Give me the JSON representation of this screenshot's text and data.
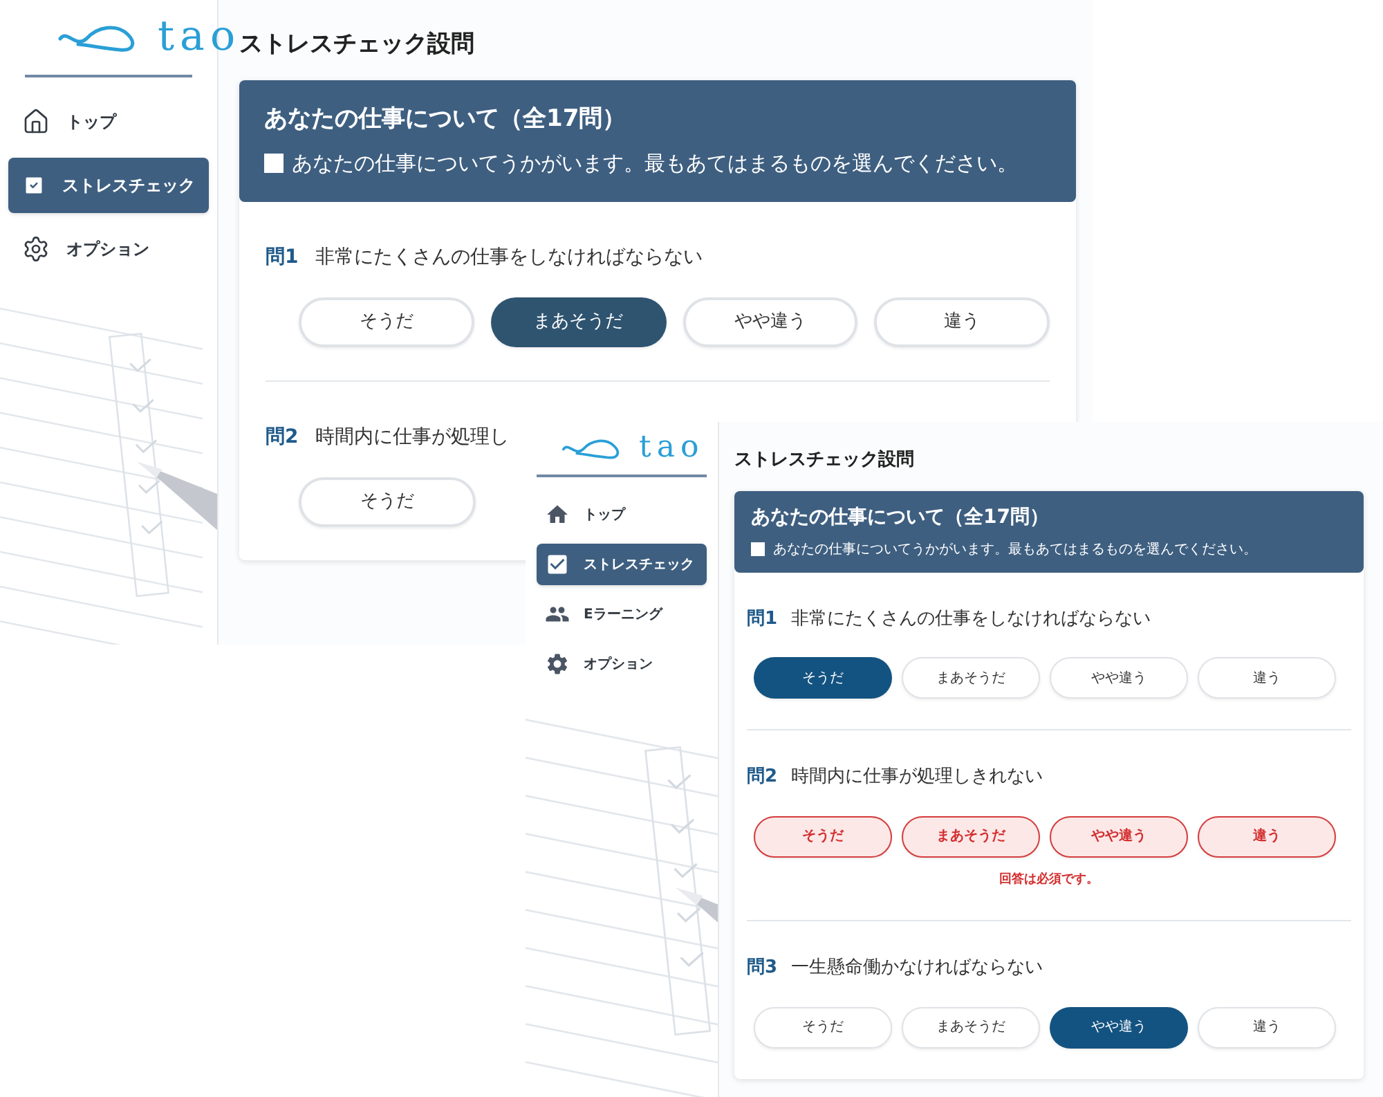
{
  "screens": [
    {
      "logo": "tao",
      "nav": [
        {
          "label": "トップ",
          "kind": "home",
          "selected": false
        },
        {
          "label": "ストレスチェック",
          "kind": "check",
          "selected": true
        },
        {
          "label": "オプション",
          "kind": "gear",
          "selected": false
        }
      ],
      "title": "ストレスチェック設問",
      "section_title": "あなたの仕事について（全17問）",
      "instruction": "あなたの仕事についてうかがいます。最もあてはまるものを選んでください。",
      "questions": [
        {
          "number": "問1",
          "text": "非常にたくさんの仕事をしなければならない",
          "error": false,
          "options": [
            {
              "label": "そうだ",
              "selected": false
            },
            {
              "label": "まあそうだ",
              "selected": true
            },
            {
              "label": "やや違う",
              "selected": false
            },
            {
              "label": "違う",
              "selected": false
            }
          ]
        },
        {
          "number": "問2",
          "text": "時間内に仕事が処理し",
          "error": false,
          "options": [
            {
              "label": "そうだ",
              "selected": false
            }
          ]
        }
      ]
    },
    {
      "logo": "tao",
      "nav": [
        {
          "label": "トップ",
          "kind": "home",
          "selected": false
        },
        {
          "label": "ストレスチェック",
          "kind": "check",
          "selected": true
        },
        {
          "label": "Eラーニング",
          "kind": "people",
          "selected": false
        },
        {
          "label": "オプション",
          "kind": "gear",
          "selected": false
        }
      ],
      "title": "ストレスチェック設問",
      "section_title": "あなたの仕事について（全17問）",
      "instruction": "あなたの仕事についてうかがいます。最もあてはまるものを選んでください。",
      "questions": [
        {
          "number": "問1",
          "text": "非常にたくさんの仕事をしなければならない",
          "error": false,
          "options": [
            {
              "label": "そうだ",
              "selected": true
            },
            {
              "label": "まあそうだ",
              "selected": false
            },
            {
              "label": "やや違う",
              "selected": false
            },
            {
              "label": "違う",
              "selected": false
            }
          ]
        },
        {
          "number": "問2",
          "text": "時間内に仕事が処理しきれない",
          "error": true,
          "error_message": "回答は必須です。",
          "options": [
            {
              "label": "そうだ",
              "selected": false
            },
            {
              "label": "まあそうだ",
              "selected": false
            },
            {
              "label": "やや違う",
              "selected": false
            },
            {
              "label": "違う",
              "selected": false
            }
          ]
        },
        {
          "number": "問3",
          "text": "一生懸命働かなければならない",
          "error": false,
          "options": [
            {
              "label": "そうだ",
              "selected": false
            },
            {
              "label": "まあそうだ",
              "selected": false
            },
            {
              "label": "やや違う",
              "selected": true
            },
            {
              "label": "違う",
              "selected": false
            }
          ]
        }
      ]
    }
  ]
}
